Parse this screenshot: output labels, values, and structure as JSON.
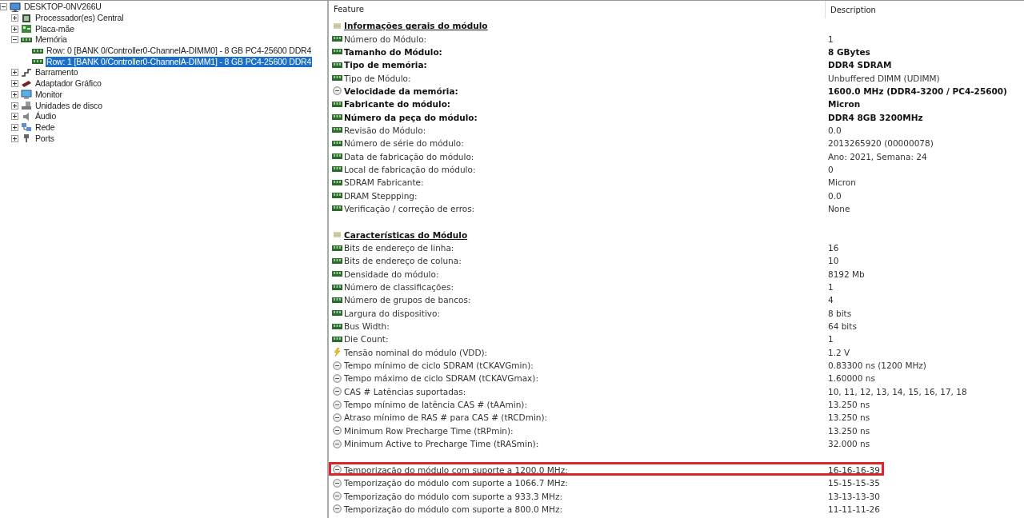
{
  "tree": [
    {
      "label": "DESKTOP-0NV266U",
      "kind": "computer",
      "expanded": true,
      "selected": false,
      "children": [
        {
          "label": "Processador(es) Central",
          "kind": "cpu",
          "expanded": false,
          "selected": false
        },
        {
          "label": "Placa-mãe",
          "kind": "motherboard",
          "expanded": false,
          "selected": false
        },
        {
          "label": "Memória",
          "kind": "memory",
          "expanded": true,
          "selected": false,
          "children": [
            {
              "label": "Row: 0 [BANK 0/Controller0-ChannelA-DIMM0] - 8 GB PC4-25600 DDR4",
              "kind": "memory",
              "selected": false
            },
            {
              "label": "Row: 1 [BANK 0/Controller0-ChannelA-DIMM1] - 8 GB PC4-25600 DDR4",
              "kind": "memory",
              "selected": true
            }
          ]
        },
        {
          "label": "Barramento",
          "kind": "bus",
          "expanded": false,
          "selected": false
        },
        {
          "label": "Adaptador Gráfico",
          "kind": "gpu",
          "expanded": false,
          "selected": false
        },
        {
          "label": "Monitor",
          "kind": "monitor",
          "expanded": false,
          "selected": false
        },
        {
          "label": "Unidades de disco",
          "kind": "disk",
          "expanded": false,
          "selected": false
        },
        {
          "label": "Áudio",
          "kind": "audio",
          "expanded": false,
          "selected": false
        },
        {
          "label": "Rede",
          "kind": "network",
          "expanded": false,
          "selected": false
        },
        {
          "label": "Ports",
          "kind": "port",
          "expanded": false,
          "selected": false
        }
      ]
    }
  ],
  "table": {
    "columns": [
      "Feature",
      "Description"
    ],
    "rows": [
      {
        "kind": "section",
        "feature": "Informações gerais do módulo"
      },
      {
        "kind": "module",
        "feature": "Número do Módulo:",
        "value": "1",
        "bold": false,
        "highlighted": false
      },
      {
        "kind": "module",
        "feature": "Tamanho do Módulo:",
        "value": "8 GBytes",
        "bold": true,
        "highlighted": false
      },
      {
        "kind": "module",
        "feature": "Tipo de memória:",
        "value": "DDR4 SDRAM",
        "bold": true,
        "highlighted": false
      },
      {
        "kind": "module",
        "feature": "Tipo de Módulo:",
        "value": "Unbuffered DIMM (UDIMM)",
        "bold": false,
        "highlighted": false
      },
      {
        "kind": "clock",
        "feature": "Velocidade da memória:",
        "value": "1600.0 MHz (DDR4-3200 / PC4-25600)",
        "bold": true,
        "highlighted": false
      },
      {
        "kind": "module",
        "feature": "Fabricante do módulo:",
        "value": "Micron",
        "bold": true,
        "highlighted": false
      },
      {
        "kind": "module",
        "feature": "Número da peça do módulo:",
        "value": "DDR4 8GB 3200MHz",
        "bold": true,
        "highlighted": false
      },
      {
        "kind": "module",
        "feature": "Revisão do Módulo:",
        "value": "0.0",
        "bold": false,
        "highlighted": false
      },
      {
        "kind": "module",
        "feature": "Número de série do módulo:",
        "value": "2013265920 (00000078)",
        "bold": false,
        "highlighted": false
      },
      {
        "kind": "module",
        "feature": "Data de fabricação do módulo:",
        "value": "Ano: 2021, Semana: 24",
        "bold": false,
        "highlighted": false
      },
      {
        "kind": "module",
        "feature": "Local de fabricação do módulo:",
        "value": "0",
        "bold": false,
        "highlighted": false
      },
      {
        "kind": "module",
        "feature": "SDRAM Fabricante:",
        "value": "Micron",
        "bold": false,
        "highlighted": false
      },
      {
        "kind": "module",
        "feature": "DRAM Steppping:",
        "value": "0.0",
        "bold": false,
        "highlighted": false
      },
      {
        "kind": "module",
        "feature": "Verificação / correção de erros:",
        "value": "None",
        "bold": false,
        "highlighted": false
      },
      {
        "kind": "blank"
      },
      {
        "kind": "section",
        "feature": "Características do Módulo"
      },
      {
        "kind": "module",
        "feature": "Bits de endereço de linha:",
        "value": "16",
        "bold": false,
        "highlighted": false
      },
      {
        "kind": "module",
        "feature": "Bits de endereço de coluna:",
        "value": "10",
        "bold": false,
        "highlighted": false
      },
      {
        "kind": "module",
        "feature": "Densidade do módulo:",
        "value": "8192 Mb",
        "bold": false,
        "highlighted": false
      },
      {
        "kind": "module",
        "feature": "Número de classificações:",
        "value": "1",
        "bold": false,
        "highlighted": false
      },
      {
        "kind": "module",
        "feature": "Número de grupos de bancos:",
        "value": "4",
        "bold": false,
        "highlighted": false
      },
      {
        "kind": "module",
        "feature": "Largura do dispositivo:",
        "value": "8 bits",
        "bold": false,
        "highlighted": false
      },
      {
        "kind": "module",
        "feature": "Bus Width:",
        "value": "64 bits",
        "bold": false,
        "highlighted": false
      },
      {
        "kind": "module",
        "feature": "Die Count:",
        "value": "1",
        "bold": false,
        "highlighted": false
      },
      {
        "kind": "bolt",
        "feature": "Tensão nominal do módulo (VDD):",
        "value": "1.2 V",
        "bold": false,
        "highlighted": false
      },
      {
        "kind": "clock",
        "feature": "Tempo mínimo de ciclo SDRAM (tCKAVGmin):",
        "value": "0.83300 ns (1200 MHz)",
        "bold": false,
        "highlighted": false
      },
      {
        "kind": "clock",
        "feature": "Tempo máximo de ciclo SDRAM (tCKAVGmax):",
        "value": "1.60000 ns",
        "bold": false,
        "highlighted": false
      },
      {
        "kind": "clock",
        "feature": "CAS # Latências suportadas:",
        "value": "10, 11, 12, 13, 14, 15, 16, 17, 18",
        "bold": false,
        "highlighted": false
      },
      {
        "kind": "clock",
        "feature": "Tempo mínimo de latência CAS # (tAAmin):",
        "value": "13.250 ns",
        "bold": false,
        "highlighted": false
      },
      {
        "kind": "clock",
        "feature": "Atraso mínimo de RAS # para CAS # (tRCDmin):",
        "value": "13.250 ns",
        "bold": false,
        "highlighted": false
      },
      {
        "kind": "clock",
        "feature": "Minimum Row Precharge Time (tRPmin):",
        "value": "13.250 ns",
        "bold": false,
        "highlighted": false
      },
      {
        "kind": "clock",
        "feature": "Minimum Active to Precharge Time (tRASmin):",
        "value": "32.000 ns",
        "bold": false,
        "highlighted": false
      },
      {
        "kind": "blank"
      },
      {
        "kind": "clock",
        "feature": "Temporização do módulo com suporte a 1200.0 MHz:",
        "value": "16-16-16-39",
        "bold": false,
        "highlighted": true
      },
      {
        "kind": "clock",
        "feature": "Temporização do módulo com suporte a 1066.7 MHz:",
        "value": "15-15-15-35",
        "bold": false,
        "highlighted": false
      },
      {
        "kind": "clock",
        "feature": "Temporização do módulo com suporte a 933.3 MHz:",
        "value": "13-13-13-30",
        "bold": false,
        "highlighted": false
      },
      {
        "kind": "clock",
        "feature": "Temporização do módulo com suporte a 800.0 MHz:",
        "value": "11-11-11-26",
        "bold": false,
        "highlighted": false
      }
    ]
  }
}
